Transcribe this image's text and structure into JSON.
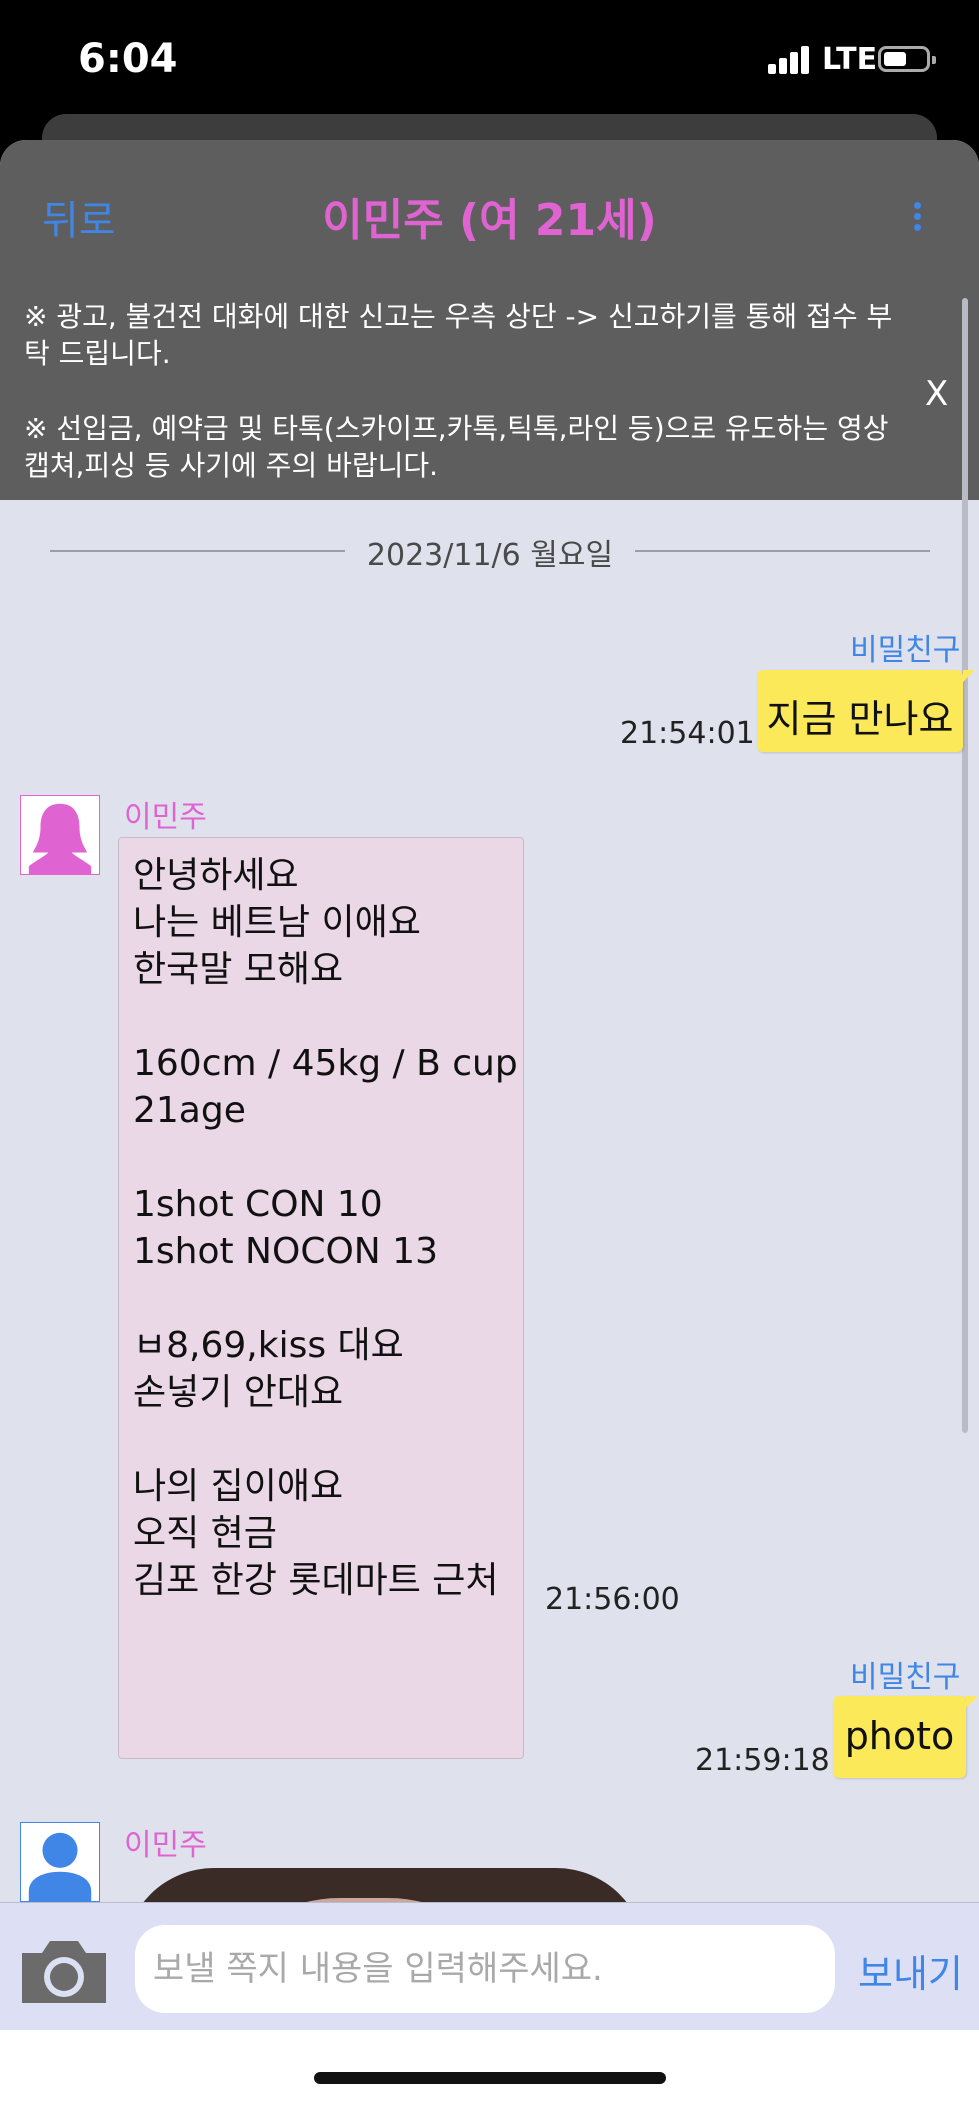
{
  "status_bar": {
    "time": "6:04",
    "network": "LTE"
  },
  "header": {
    "back_label": "뒤로",
    "title": "이민주 (여 21세)",
    "more_icon": "vertical-ellipsis-icon"
  },
  "notice": {
    "line1": "※ 광고, 불건전 대화에 대한 신고는 우측 상단 -> 신고하기를 통해 접수 부탁 드립니다.",
    "line2": "※ 선입금, 예약금 및 타톡(스카이프,카톡,틱톡,라인 등)으로 유도하는 영상캡쳐,피싱 등 사기에 주의 바랍니다.",
    "close_label": "X"
  },
  "date_divider": "2023/11/6 월요일",
  "messages": [
    {
      "from": "me",
      "name": "비밀친구",
      "text": "지금 만나요",
      "time": "21:54:01"
    },
    {
      "from": "partner",
      "name": "이민주",
      "lines": [
        "안녕하세요",
        "나는 베트남 이애요",
        "한국말 모해요",
        "",
        "160cm / 45kg / B cup",
        "21age",
        "",
        "1shot CON 10",
        "1shot NOCON 13",
        "",
        "ㅂ8,69,kiss 대요",
        "손넣기 안대요",
        "",
        "나의 집이애요",
        "오직 현금",
        "김포 한강 롯데마트 근처"
      ],
      "time": "21:56:00"
    },
    {
      "from": "me",
      "name": "비밀친구",
      "text": "photo",
      "time": "21:59:18"
    },
    {
      "from": "partner",
      "name": "이민주",
      "type": "photo"
    }
  ],
  "composer": {
    "placeholder": "보낼 쪽지 내용을 입력해주세요.",
    "send_label": "보내기",
    "camera_icon": "camera-icon"
  },
  "colors": {
    "accent_blue": "#3f86e6",
    "partner_pink": "#e063d2",
    "my_bubble": "#fbe95a",
    "partner_bubble": "#ead8e6",
    "chat_bg": "#dfe2ec"
  }
}
